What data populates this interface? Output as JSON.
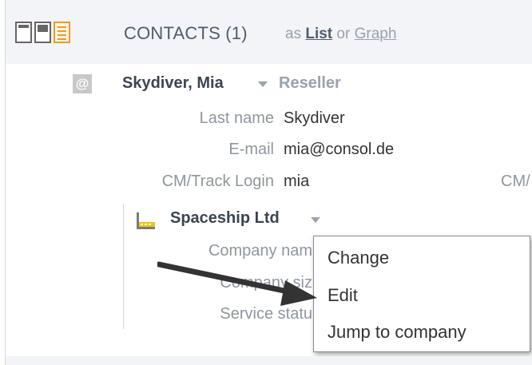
{
  "header": {
    "title": "CONTACTS (1)",
    "as_text": "as",
    "list_link": "List",
    "or_text": "or",
    "graph_link": "Graph",
    "view_icons": [
      "compact-view-icon",
      "detail-view-icon",
      "card-view-icon"
    ],
    "active_color": "#f19a1c"
  },
  "contact": {
    "icon": "at-sign-icon",
    "icon_glyph": "@",
    "name": "Skydiver, Mia",
    "role": "Reseller",
    "fields": [
      {
        "label": "Last name",
        "value": "Skydiver"
      },
      {
        "label": "E-mail",
        "value": "mia@consol.de"
      },
      {
        "label": "CM/Track Login",
        "value": "mia"
      }
    ],
    "cut_label": "CM/"
  },
  "company": {
    "icon": "factory-icon",
    "name": "Spaceship Ltd",
    "fields": [
      {
        "label": "Company nam"
      },
      {
        "label": "Company siz"
      },
      {
        "label": "Service statu"
      }
    ]
  },
  "context_menu": {
    "items": [
      "Change",
      "Edit",
      "Jump to company"
    ]
  }
}
